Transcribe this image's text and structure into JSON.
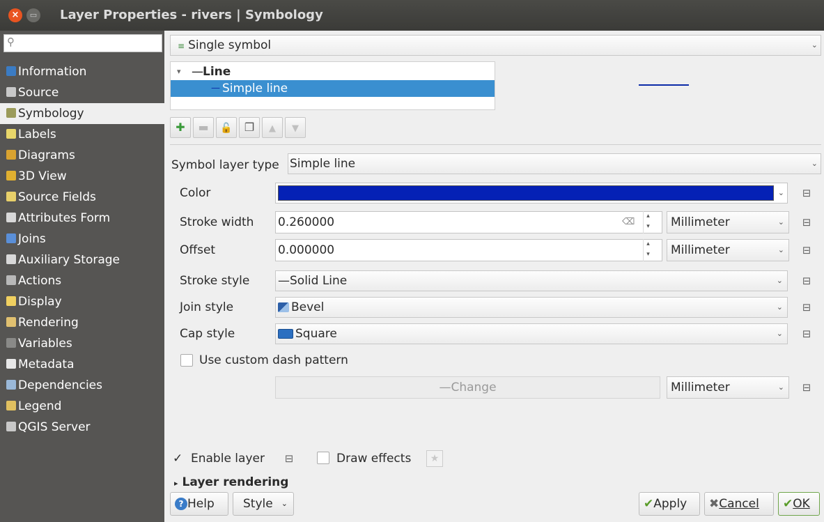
{
  "window": {
    "title": "Layer Properties - rivers | Symbology",
    "close_glyph": "×",
    "min_glyph": "▭"
  },
  "sidebar": {
    "search_placeholder": "",
    "items": [
      {
        "label": "Information",
        "icon": "info-icon",
        "color": "#3b7cc4"
      },
      {
        "label": "Source",
        "icon": "source-icon",
        "color": "#c8c8c8"
      },
      {
        "label": "Symbology",
        "icon": "symbology-icon",
        "color": "#9b9b5a"
      },
      {
        "label": "Labels",
        "icon": "labels-icon",
        "color": "#e8d66a"
      },
      {
        "label": "Diagrams",
        "icon": "diagrams-icon",
        "color": "#d9a330"
      },
      {
        "label": "3D View",
        "icon": "3d-view-icon",
        "color": "#e0b030"
      },
      {
        "label": "Source Fields",
        "icon": "source-fields-icon",
        "color": "#e8d06a"
      },
      {
        "label": "Attributes Form",
        "icon": "attributes-form-icon",
        "color": "#d8d8d8"
      },
      {
        "label": "Joins",
        "icon": "joins-icon",
        "color": "#5a8fd8"
      },
      {
        "label": "Auxiliary Storage",
        "icon": "auxiliary-storage-icon",
        "color": "#d8d8d8"
      },
      {
        "label": "Actions",
        "icon": "actions-icon",
        "color": "#b8b8b8"
      },
      {
        "label": "Display",
        "icon": "display-icon",
        "color": "#f0d060"
      },
      {
        "label": "Rendering",
        "icon": "rendering-icon",
        "color": "#e0c070"
      },
      {
        "label": "Variables",
        "icon": "variables-icon",
        "color": "#8a8a88"
      },
      {
        "label": "Metadata",
        "icon": "metadata-icon",
        "color": "#e8e8e8"
      },
      {
        "label": "Dependencies",
        "icon": "dependencies-icon",
        "color": "#9ab8d8"
      },
      {
        "label": "Legend",
        "icon": "legend-icon",
        "color": "#e0c060"
      },
      {
        "label": "QGIS Server",
        "icon": "qgis-server-icon",
        "color": "#c8c8c8"
      }
    ],
    "active_index": 2
  },
  "renderer": {
    "label": "Single symbol",
    "arrow": "⌄"
  },
  "tree": {
    "toggle": "▾",
    "root_dash": "—",
    "root_label": "Line",
    "child_dash": "—",
    "child_label": "Simple line"
  },
  "toolbar": {
    "add": "✚",
    "remove": "▬",
    "lock": "🔓",
    "duplicate": "❐",
    "up": "▲",
    "down": "▼"
  },
  "symbol_layer_type": {
    "label": "Symbol layer type",
    "value": "Simple line"
  },
  "props": {
    "color": {
      "label": "Color",
      "swatch": "#0521b5"
    },
    "stroke_width": {
      "label": "Stroke width",
      "value": "0.260000",
      "unit": "Millimeter",
      "clear_glyph": "⌫"
    },
    "offset": {
      "label": "Offset",
      "value": "0.000000",
      "unit": "Millimeter"
    },
    "stroke_style": {
      "label": "Stroke style",
      "value": "Solid Line",
      "prefix": "—"
    },
    "join_style": {
      "label": "Join style",
      "value": "Bevel"
    },
    "cap_style": {
      "label": "Cap style",
      "value": "Square"
    },
    "custom_dash": {
      "label": "Use custom dash pattern",
      "checked": false
    },
    "change": {
      "label": "Change",
      "prefix": "—",
      "unit": "Millimeter"
    },
    "dd_glyph": "⊟"
  },
  "footer": {
    "enable_layer": {
      "label": "Enable layer",
      "checked": true,
      "check_glyph": "✓"
    },
    "draw_effects": {
      "label": "Draw effects",
      "checked": false,
      "star": "★"
    },
    "layer_rendering": {
      "label": "Layer rendering",
      "toggle": "▸"
    }
  },
  "buttons": {
    "help": "Help",
    "help_glyph": "?",
    "style": "Style",
    "apply": "Apply",
    "apply_glyph": "✔",
    "cancel": "Cancel",
    "cancel_glyph": "✖",
    "ok": "OK",
    "ok_glyph": "✔"
  }
}
